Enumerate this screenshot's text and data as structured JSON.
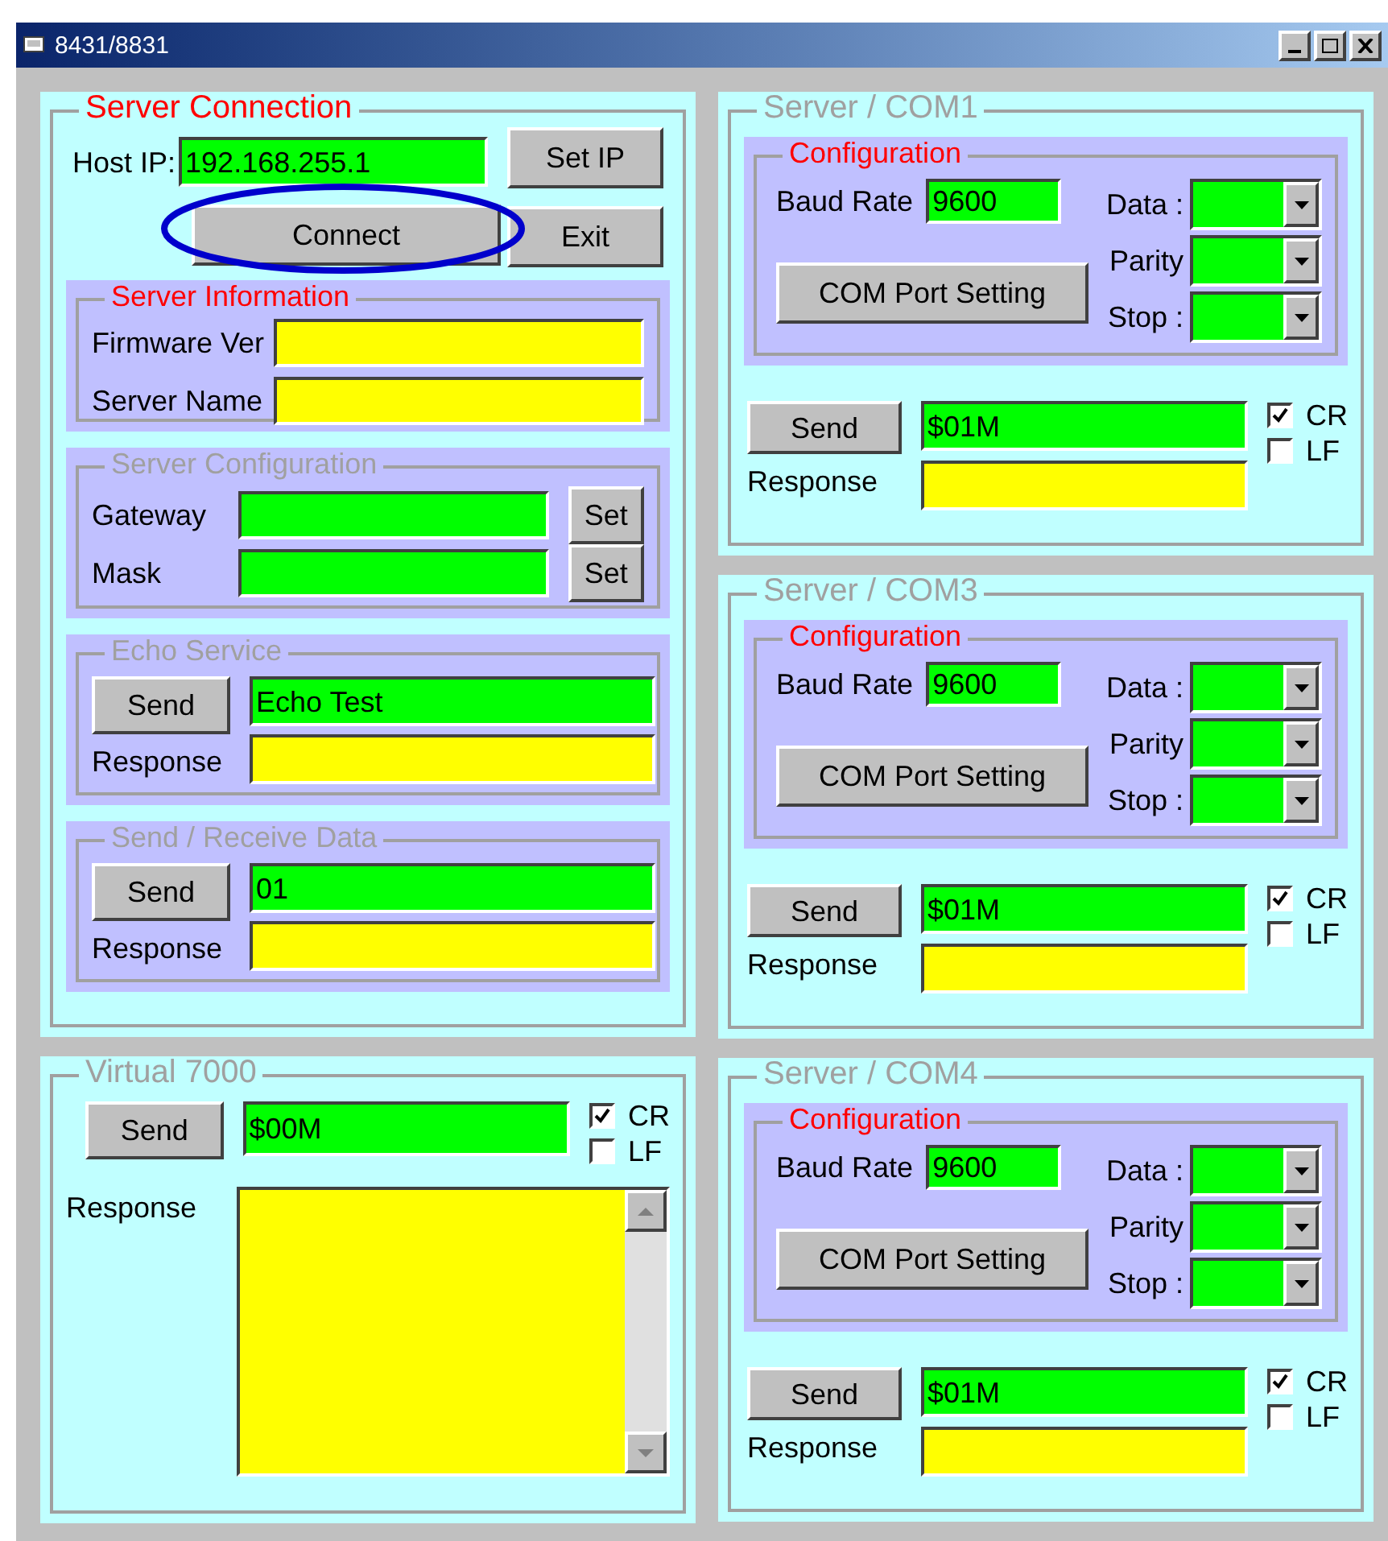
{
  "window": {
    "title": "8431/8831"
  },
  "server_connection": {
    "title": "Server Connection",
    "disabled": false,
    "host_ip_label": "Host IP:",
    "host_ip": "192.168.255.1",
    "set_ip_button": "Set IP",
    "connect_button": "Connect",
    "connect_highlighted": true,
    "exit_button": "Exit",
    "server_information": {
      "title": "Server Information",
      "disabled": false,
      "fields": [
        {
          "label": "Firmware Ver"
        },
        {
          "label": "Server Name"
        }
      ]
    },
    "server_configuration": {
      "title": "Server Configuration",
      "disabled": true,
      "fields": [
        {
          "label": "Gateway",
          "button": "Set"
        },
        {
          "label": "Mask",
          "button": "Set"
        }
      ]
    },
    "echo_service": {
      "title": "Echo Service",
      "disabled": true,
      "send_button": "Send",
      "value": "Echo Test",
      "response_label": "Response"
    },
    "send_receive": {
      "title": "Send / Receive Data",
      "disabled": true,
      "send_button": "Send",
      "value": "01",
      "response_label": "Response"
    }
  },
  "virtual_7000": {
    "title": "Virtual 7000",
    "disabled": true,
    "send_button": "Send",
    "value": "$00M",
    "checkboxes": [
      {
        "label": "CR",
        "checked": true
      },
      {
        "label": "LF",
        "checked": false
      }
    ],
    "response_label": "Response"
  },
  "com_panels": [
    {
      "title": "Server / COM1",
      "disabled": true,
      "configuration": {
        "title": "Configuration",
        "disabled": false,
        "baud_label": "Baud Rate",
        "baud": "9600",
        "port_button": "COM Port Setting",
        "selects": [
          {
            "label": "Data :"
          },
          {
            "label": "Parity"
          },
          {
            "label": "Stop :"
          }
        ]
      },
      "send_button": "Send",
      "value": "$01M",
      "checkboxes": [
        {
          "label": "CR",
          "checked": true
        },
        {
          "label": "LF",
          "checked": false
        }
      ],
      "response_label": "Response"
    },
    {
      "title": "Server / COM3",
      "disabled": true,
      "configuration": {
        "title": "Configuration",
        "disabled": false,
        "baud_label": "Baud Rate",
        "baud": "9600",
        "port_button": "COM Port Setting",
        "selects": [
          {
            "label": "Data :"
          },
          {
            "label": "Parity"
          },
          {
            "label": "Stop :"
          }
        ]
      },
      "send_button": "Send",
      "value": "$01M",
      "checkboxes": [
        {
          "label": "CR",
          "checked": true
        },
        {
          "label": "LF",
          "checked": false
        }
      ],
      "response_label": "Response"
    },
    {
      "title": "Server / COM4",
      "disabled": true,
      "configuration": {
        "title": "Configuration",
        "disabled": false,
        "baud_label": "Baud Rate",
        "baud": "9600",
        "port_button": "COM Port Setting",
        "selects": [
          {
            "label": "Data :"
          },
          {
            "label": "Parity"
          },
          {
            "label": "Stop :"
          }
        ]
      },
      "send_button": "Send",
      "value": "$01M",
      "checkboxes": [
        {
          "label": "CR",
          "checked": true
        },
        {
          "label": "LF",
          "checked": false
        }
      ],
      "response_label": "Response"
    }
  ]
}
